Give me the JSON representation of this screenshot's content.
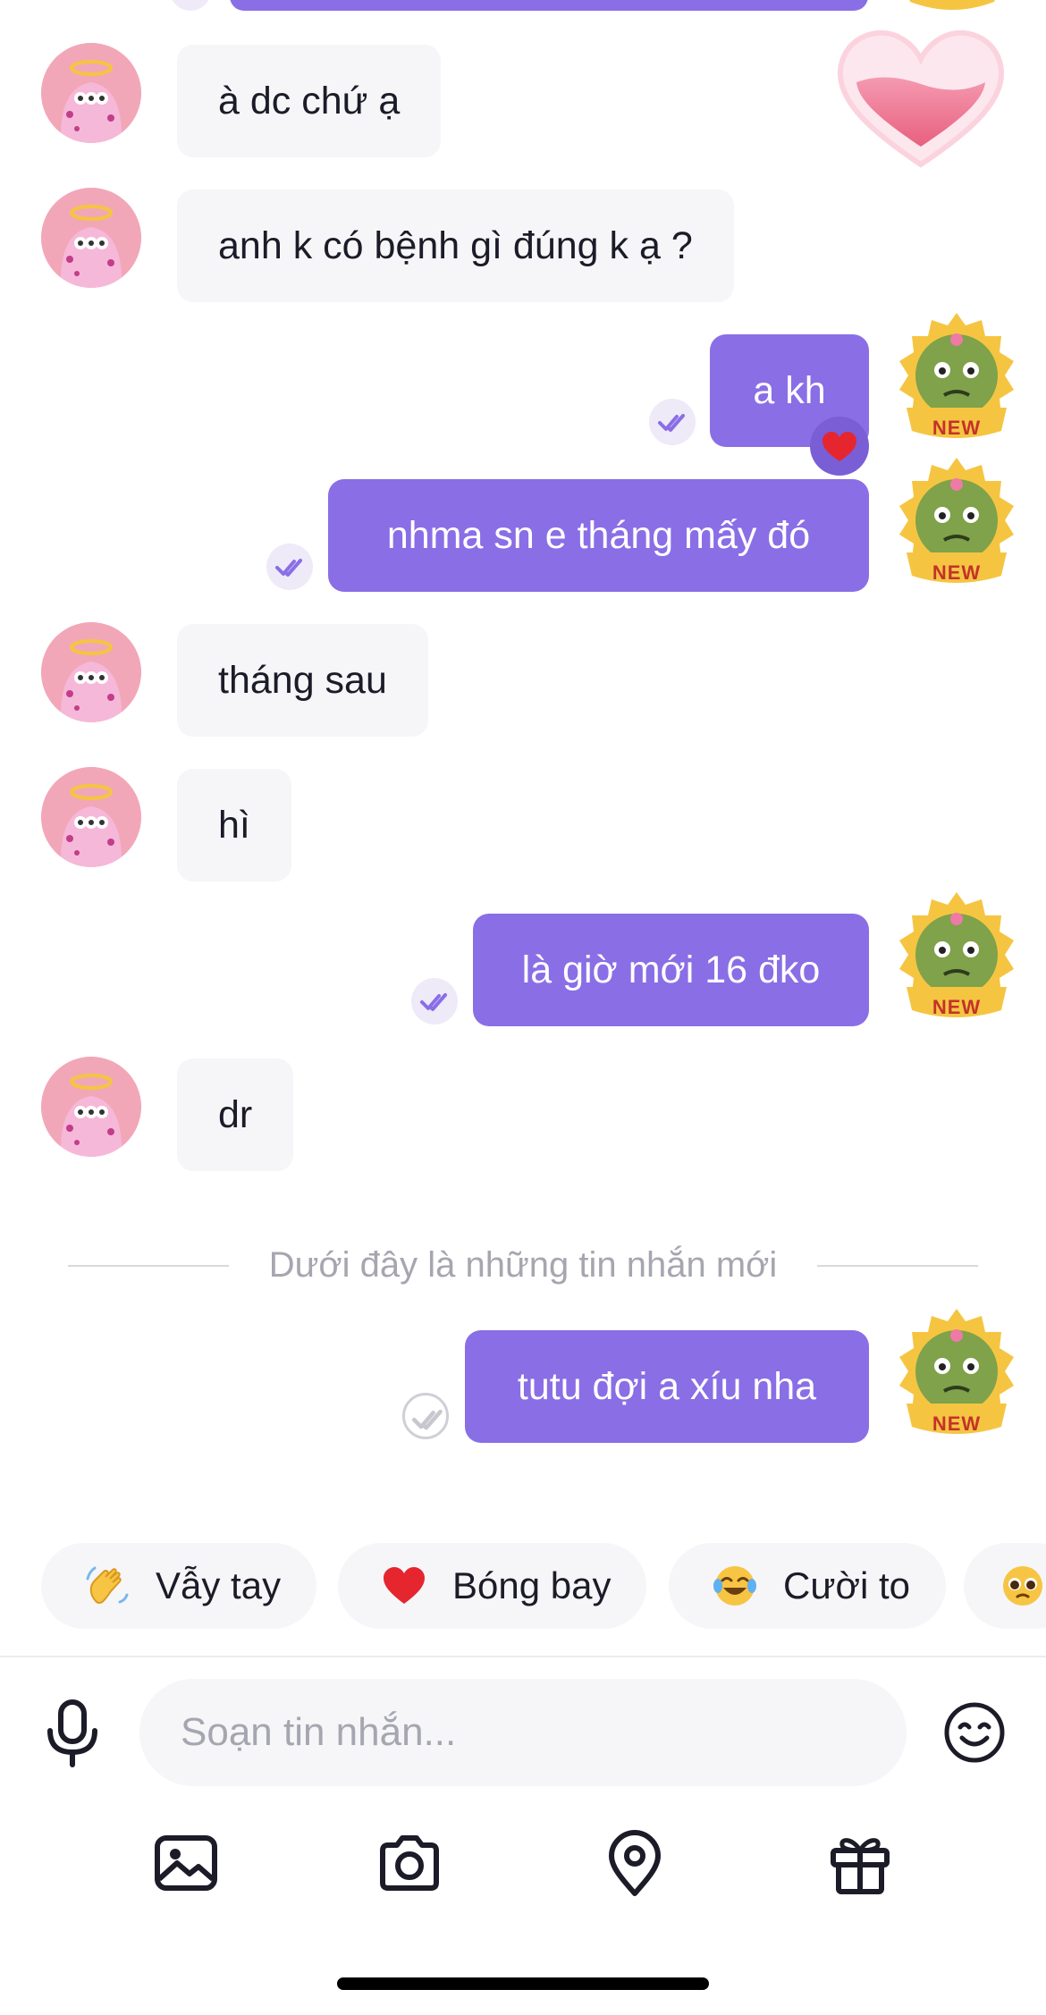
{
  "messages": [
    {
      "side": "in",
      "text": "à dc chứ ạ"
    },
    {
      "side": "in",
      "text": "anh k có bệnh gì đúng k ạ ?"
    },
    {
      "side": "out",
      "text": "a kh",
      "reaction": "heart"
    },
    {
      "side": "out",
      "text": "nhma sn e tháng mấy đó"
    },
    {
      "side": "in",
      "text": "tháng sau"
    },
    {
      "side": "in",
      "text": "hì"
    },
    {
      "side": "out",
      "text": "là giờ mới 16 đko"
    },
    {
      "side": "in",
      "text": "dr"
    },
    {
      "side": "out",
      "text": "tutu đợi a xíu nha",
      "status": "sent"
    }
  ],
  "badge_label": "NEW",
  "new_messages_divider": "Dưới đây là những tin nhắn mới",
  "quick_reactions": [
    {
      "emoji": "waving-hand",
      "label": "Vẫy tay"
    },
    {
      "emoji": "red-heart",
      "label": "Bóng bay"
    },
    {
      "emoji": "tears-of-joy",
      "label": "Cười to"
    },
    {
      "emoji": "pleading-face",
      "label": ""
    }
  ],
  "composer": {
    "placeholder": "Soạn tin nhắn..."
  },
  "toolbar": [
    "image-icon",
    "camera-icon",
    "location-icon",
    "gift-icon"
  ],
  "colors": {
    "outgoing_bubble": "#8a6ee6",
    "incoming_bubble": "#f6f6f9",
    "accent": "#8a6ee6"
  }
}
